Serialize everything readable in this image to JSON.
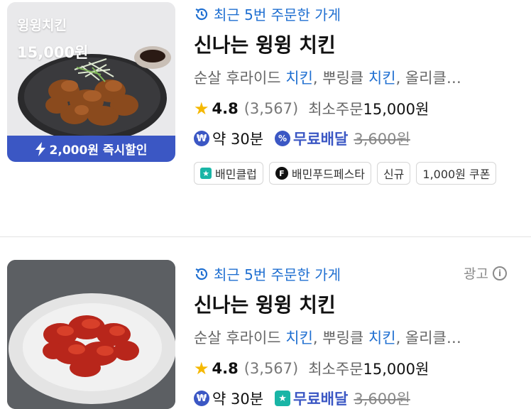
{
  "stores": [
    {
      "thumb_name": "윙윙치킨",
      "thumb_price": "15,000원",
      "discount_label": "2,000원 즉시할인",
      "recent_label": "최근 5번 주문한 가게",
      "name": "신나는 윙윙 치킨",
      "menu": [
        {
          "text": "순살 후라이드 ",
          "hl": false
        },
        {
          "text": "치킨",
          "hl": true
        },
        {
          "text": ", 뿌링클 ",
          "hl": false
        },
        {
          "text": "치킨",
          "hl": true
        },
        {
          "text": ", 올리클…",
          "hl": false
        }
      ],
      "rating": "4.8",
      "reviews": "(3,567)",
      "min_order_label": "최소주문",
      "min_order_value": "15,000원",
      "delivery_time": "약 30분",
      "free_delivery_label": "무료배달",
      "original_fee": "3,600원",
      "tags": [
        "배민클럽",
        "배민푸드페스타",
        "신규",
        "1,000원 쿠폰"
      ]
    },
    {
      "recent_label": "최근 5번 주문한 가게",
      "ad_label": "광고",
      "name": "신나는 윙윙 치킨",
      "menu": [
        {
          "text": "순살 후라이드 ",
          "hl": false
        },
        {
          "text": "치킨",
          "hl": true
        },
        {
          "text": ", 뿌링클 ",
          "hl": false
        },
        {
          "text": "치킨",
          "hl": true
        },
        {
          "text": ", 올리클…",
          "hl": false
        }
      ],
      "rating": "4.8",
      "reviews": "(3,567)",
      "min_order_label": "최소주문",
      "min_order_value": "15,000원",
      "delivery_time": "약 30분",
      "free_delivery_label": "무료배달",
      "original_fee": "3,600원"
    }
  ],
  "icons": {
    "recent": "clock-history-icon",
    "star": "star-icon",
    "won": "won-coin-icon",
    "free_badge_1": "percent-badge-icon",
    "free_badge_2": "baemin-club-icon",
    "info": "info-icon",
    "lightning": "lightning-icon"
  },
  "colors": {
    "accent_blue": "#1f6fd1",
    "brand_navy": "#3b57c4",
    "club_teal": "#19b5a6",
    "star": "#f5b800"
  }
}
